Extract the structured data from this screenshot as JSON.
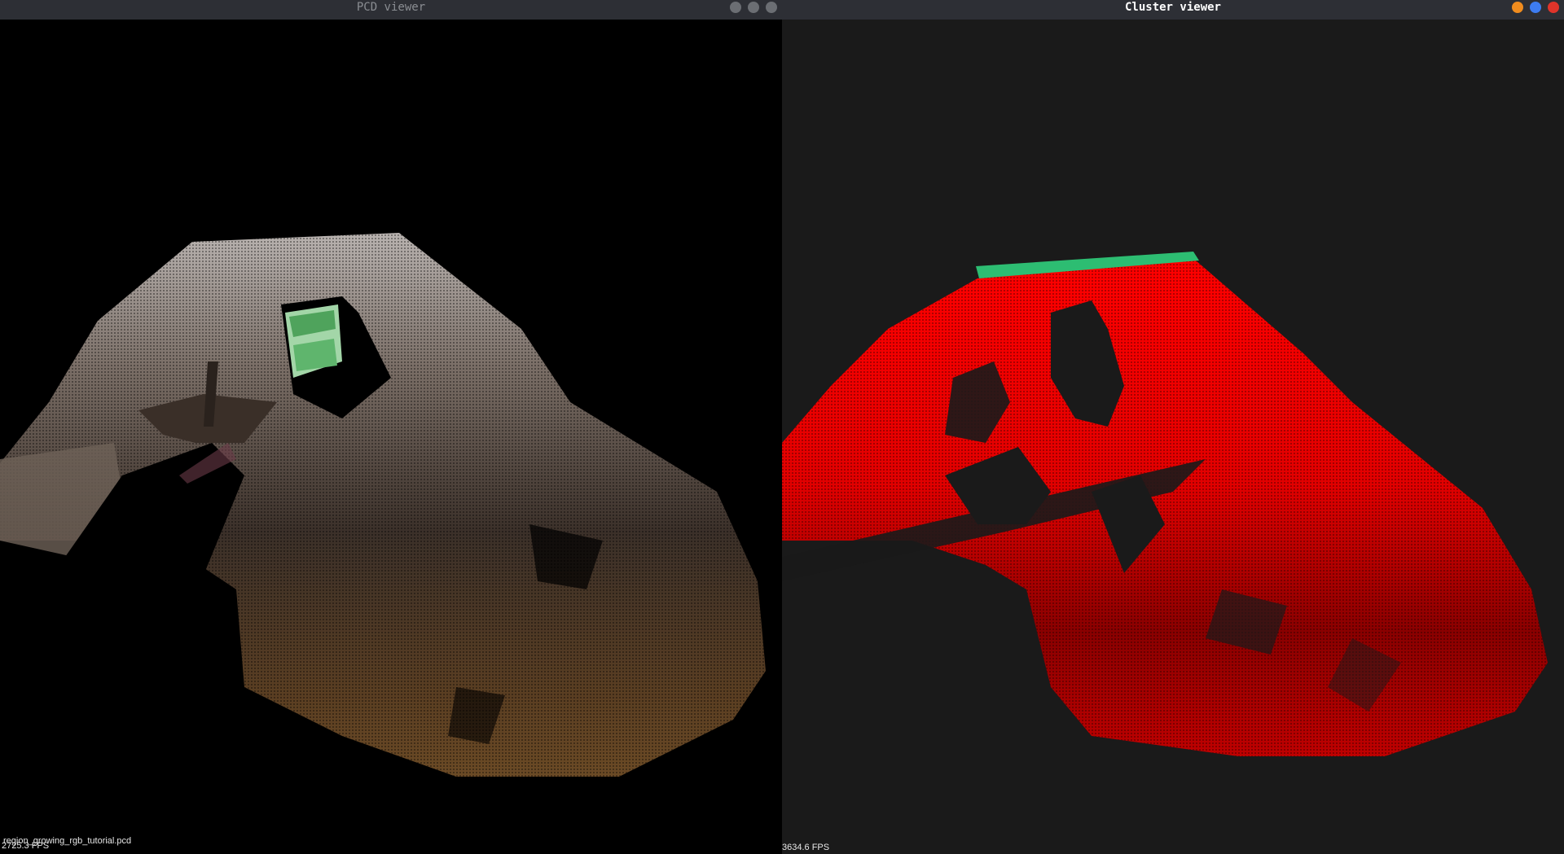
{
  "pcd_viewer": {
    "title": "PCD viewer",
    "fps_text": "2725.3 FPS",
    "file_name": "region_growing_rgb_tutorial.pcd",
    "window_controls": [
      {
        "name": "minimize-button",
        "color": "#6b6e73"
      },
      {
        "name": "maximize-button",
        "color": "#6b6e73"
      },
      {
        "name": "close-button",
        "color": "#6b6e73"
      }
    ]
  },
  "cluster_viewer": {
    "title": "Cluster viewer",
    "fps_text": "3634.6 FPS",
    "window_controls": [
      {
        "name": "minimize-button",
        "color": "#f08c1e"
      },
      {
        "name": "maximize-button",
        "color": "#3d7cf0"
      },
      {
        "name": "close-button",
        "color": "#e0342a"
      }
    ]
  },
  "colors": {
    "pcd_background": "#000000",
    "cluster_background": "#1a1a1a",
    "titlebar": "#2d2f35",
    "cluster_red": "#ff0000",
    "cluster_green": "#2dbd72"
  }
}
